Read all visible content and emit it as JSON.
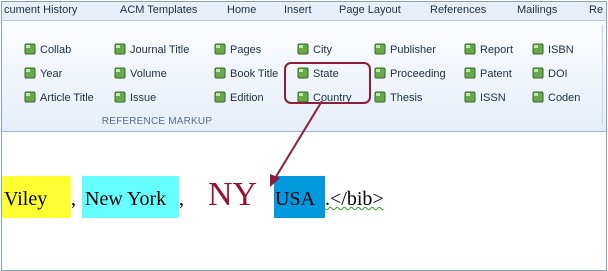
{
  "tabs": [
    "cument History",
    "ACM Templates",
    "Home",
    "Insert",
    "Page Layout",
    "References",
    "Mailings",
    "Re"
  ],
  "ribbon": {
    "rows": [
      [
        "Collab",
        "Journal Title",
        "Pages",
        "City",
        "Publisher",
        "Report",
        "ISBN"
      ],
      [
        "Year",
        "Volume",
        "Book Title",
        "State",
        "Proceeding",
        "Patent",
        "DOI"
      ],
      [
        "Article Title",
        "Issue",
        "Edition",
        "Country",
        "Thesis",
        "ISSN",
        "Coden"
      ]
    ],
    "group_label": "REFERENCE MARKUP"
  },
  "document": {
    "segments": [
      "Viley",
      ", ",
      "New York",
      ", ",
      "NY",
      " ",
      "USA",
      ".</bib>"
    ]
  },
  "colors": {
    "accent": "#8b1e3a",
    "highlight_yellow": "#ffff33",
    "highlight_cyan": "#66ffff",
    "highlight_blue": "#0099dd",
    "ny_text": "#9c1030"
  },
  "icon": "document-cube-icon"
}
